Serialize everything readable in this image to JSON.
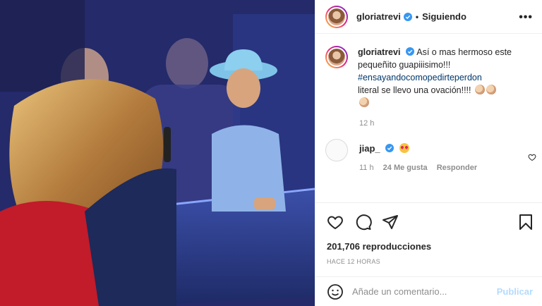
{
  "post": {
    "username": "gloriatrevi",
    "follow_status": "Siguiendo",
    "more_label": "•••",
    "caption_text": "Así o mas hermoso este pequeñito guapiiisimo!!!",
    "hashtag": "#ensayandocomopedirteperdon",
    "caption_tail": "literal se llevo una ovación!!!!",
    "caption_time": "12 h"
  },
  "comment": {
    "username": "jiap_",
    "time": "11 h",
    "likes": "24 Me gusta",
    "reply": "Responder"
  },
  "stats": {
    "views": "201,706 reproducciones",
    "posted": "HACE 12 HORAS"
  },
  "composer": {
    "placeholder": "Añade un comentario...",
    "publish": "Publicar"
  },
  "colors": {
    "verified": "#3897f0",
    "link": "#00376b",
    "publish": "#b3dbff"
  }
}
